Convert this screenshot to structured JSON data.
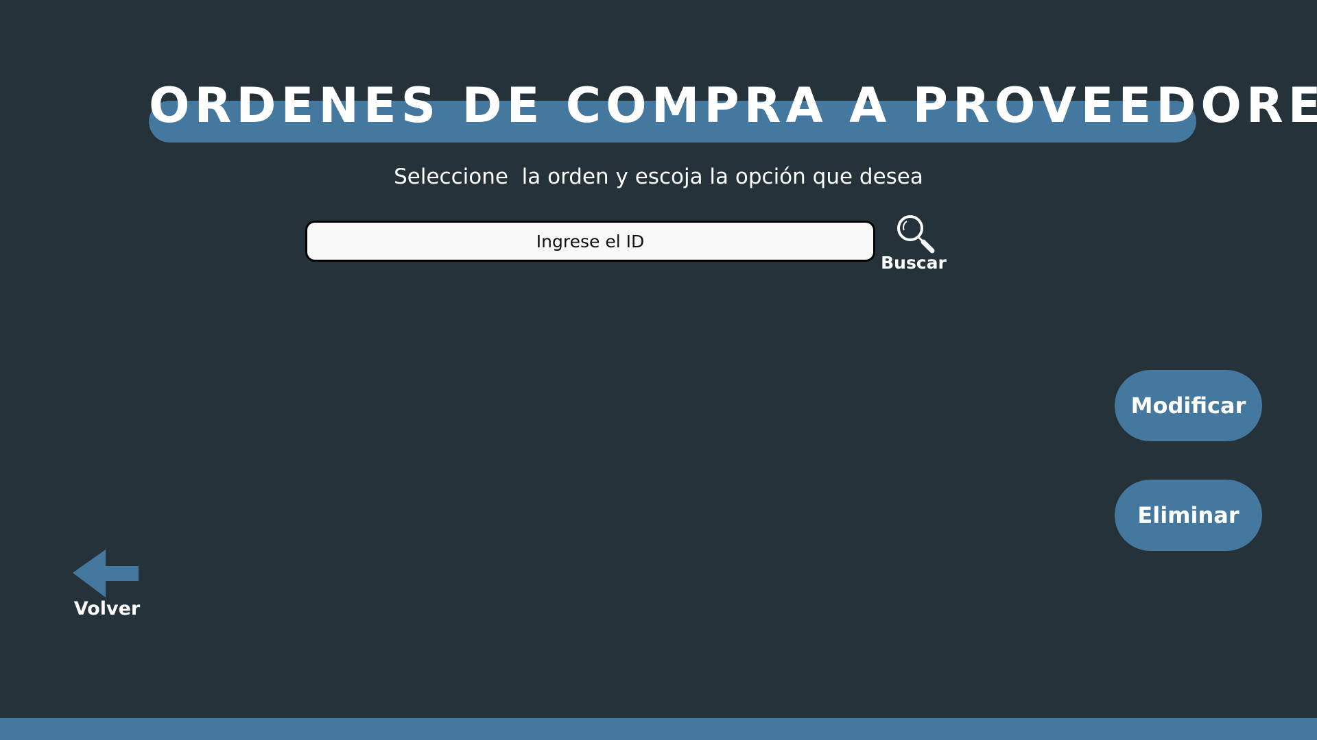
{
  "header": {
    "title": "ORDENES DE COMPRA A PROVEEDORES",
    "subtitle": "Seleccione  la orden y escoja la opción que desea"
  },
  "search": {
    "placeholder": "Ingrese el ID",
    "button_label": "Buscar",
    "icon": "search-icon"
  },
  "actions": {
    "modify_label": "Modificar",
    "delete_label": "Eliminar"
  },
  "navigation": {
    "back_label": "Volver",
    "back_icon": "arrow-left-icon"
  },
  "colors": {
    "background": "#25323a",
    "accent": "#44789e",
    "text": "#ffffff",
    "input_background": "#f8f8f8"
  }
}
